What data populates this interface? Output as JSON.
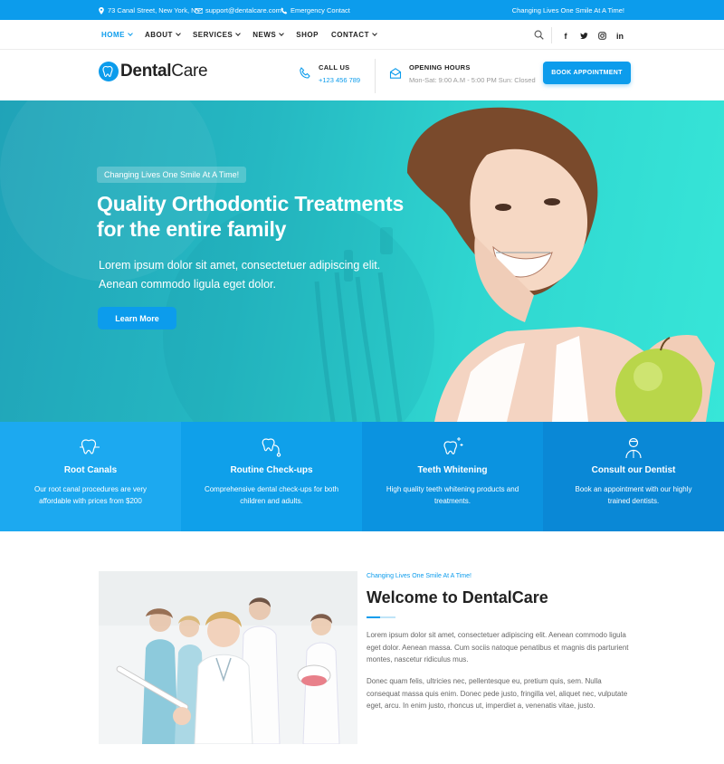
{
  "topbar": {
    "address": "73 Canal Street, New York, NY",
    "email": "support@dentalcare.com",
    "emergency": "Emergency Contact",
    "tagline": "Changing Lives One Smile At A Time!"
  },
  "nav": {
    "items": [
      {
        "label": "HOME",
        "dropdown": true,
        "active": true
      },
      {
        "label": "ABOUT",
        "dropdown": true
      },
      {
        "label": "SERVICES",
        "dropdown": true
      },
      {
        "label": "NEWS",
        "dropdown": true
      },
      {
        "label": "SHOP",
        "dropdown": false
      },
      {
        "label": "CONTACT",
        "dropdown": true
      }
    ],
    "social": [
      "f",
      "t",
      "ig",
      "in"
    ]
  },
  "header": {
    "brand_prefix": "Dental",
    "brand_suffix": "Care",
    "call_label": "CALL US",
    "call_value": "+123 456 789",
    "hours_label": "OPENING HOURS",
    "hours_value": "Mon-Sat: 9:00 A.M - 5:00 PM Sun: Closed",
    "book_label": "BOOK APPOINTMENT"
  },
  "hero": {
    "pill": "Changing Lives One Smile At A Time!",
    "title_line1": "Quality Orthodontic Treatments",
    "title_line2": "for the entire family",
    "sub_line1": "Lorem ipsum dolor sit amet, consectetuer adipiscing elit.",
    "sub_line2": "Aenean commodo ligula eget dolor.",
    "cta": "Learn More"
  },
  "features": [
    {
      "title": "Root Canals",
      "desc": "Our root canal procedures are very affordable with prices from $200",
      "icon": "tooth-icon",
      "color": "#1ca9f0"
    },
    {
      "title": "Routine Check-ups",
      "desc": "Comprehensive dental check-ups for both children and adults.",
      "icon": "stethoscope-tooth-icon",
      "color": "#0fa0ea"
    },
    {
      "title": "Teeth Whitening",
      "desc": "High quality teeth whitening products and treatments.",
      "icon": "sparkle-tooth-icon",
      "color": "#0b93e0"
    },
    {
      "title": "Consult our Dentist",
      "desc": "Book an appointment with our highly trained dentists.",
      "icon": "dentist-icon",
      "color": "#0a88d6"
    }
  ],
  "about": {
    "kicker": "Changing Lives One Smile At A Time!",
    "title": "Welcome to DentalCare",
    "p1": "Lorem ipsum dolor sit amet, consectetuer adipiscing elit. Aenean commodo ligula eget dolor. Aenean massa. Cum sociis natoque penatibus et magnis dis parturient montes, nascetur ridiculus mus.",
    "p2": "Donec quam felis, ultricies nec, pellentesque eu, pretium quis, sem. Nulla consequat massa quis enim. Donec pede justo, fringilla vel, aliquet nec, vulputate eget, arcu. In enim justo, rhoncus ut, imperdiet a, venenatis vitae, justo."
  },
  "colors": {
    "accent": "#0c9cec",
    "hero_start": "#20a3b8",
    "hero_end": "#37e6d8"
  }
}
